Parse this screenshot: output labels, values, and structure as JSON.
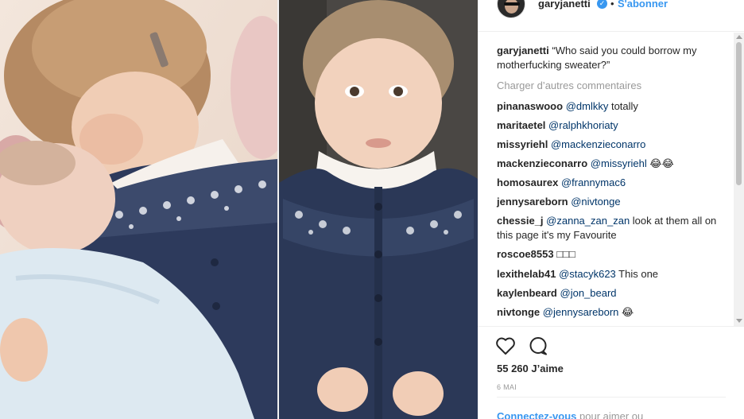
{
  "post": {
    "username": "garyjanetti",
    "verified_icon": "verified-badge-icon",
    "separator": "•",
    "follow_label": "S'abonner"
  },
  "caption": {
    "username": "garyjanetti",
    "text": "“Who said you could borrow my motherfucking sweater?”"
  },
  "load_more_label": "Charger d’autres commentaires",
  "comments": [
    {
      "user": "pinanaswooo",
      "mention": "@dmlkky",
      "text": " totally"
    },
    {
      "user": "maritaetel",
      "mention": "@ralphkhoriaty",
      "text": ""
    },
    {
      "user": "missyriehl",
      "mention": "@mackenzieconarro",
      "text": ""
    },
    {
      "user": "mackenzieconarro",
      "mention": "@missyriehl",
      "text": " 😂😂"
    },
    {
      "user": "homosaurex",
      "mention": "@frannymac6",
      "text": ""
    },
    {
      "user": "jennysareborn",
      "mention": "@nivtonge",
      "text": ""
    },
    {
      "user": "chessie_j",
      "mention": "@zanna_zan_zan",
      "text": " look at them all on this page it's my Favourite"
    },
    {
      "user": "roscoe8553",
      "mention": "",
      "text": "□□□"
    },
    {
      "user": "lexithelab41",
      "mention": "@stacyk623",
      "text": " This one"
    },
    {
      "user": "kaylenbeard",
      "mention": "@jon_beard",
      "text": ""
    },
    {
      "user": "nivtonge",
      "mention": "@jennysareborn",
      "text": " 😂"
    }
  ],
  "actions": {
    "like_icon": "heart-icon",
    "comment_icon": "comment-bubble-icon"
  },
  "likes_label": "55 260 J’aime",
  "date_label": "6 MAI",
  "login": {
    "link": "Connectez-vous",
    "text": " pour aimer ou"
  },
  "colors": {
    "link_blue": "#3897f0",
    "mention_blue": "#003569",
    "muted_gray": "#999999"
  }
}
